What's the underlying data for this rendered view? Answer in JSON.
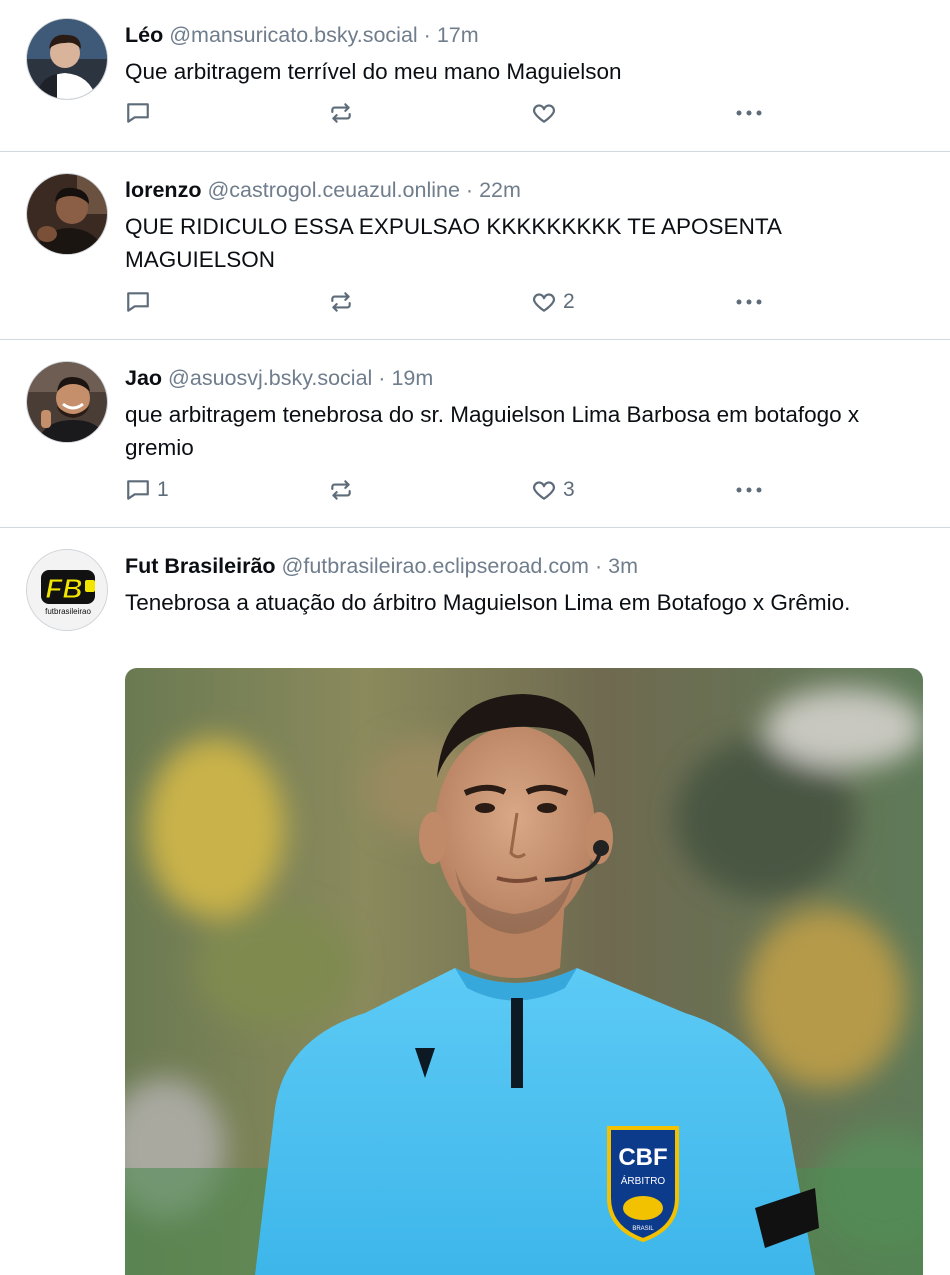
{
  "posts": [
    {
      "author": "Léo",
      "handle": "@mansuricato.bsky.social",
      "separator": "·",
      "time": "17m",
      "text": "Que arbitragem terrível do meu mano Maguielson",
      "reply_count": "",
      "like_count": ""
    },
    {
      "author": "lorenzo",
      "handle": "@castrogol.ceuazul.online",
      "separator": "·",
      "time": "22m",
      "text": "QUE RIDICULO ESSA EXPULSAO KKKKKKKKK TE APOSENTA MAGUIELSON",
      "reply_count": "",
      "like_count": "2"
    },
    {
      "author": "Jao",
      "handle": "@asuosvj.bsky.social",
      "separator": "·",
      "time": "19m",
      "text": "que arbitragem tenebrosa do sr. Maguielson Lima Barbosa em botafogo x gremio",
      "reply_count": "1",
      "like_count": "3"
    },
    {
      "author": "Fut Brasileirão",
      "handle": "@futbrasileirao.eclipseroad.com",
      "separator": "·",
      "time": "3m",
      "text": "Tenebrosa a atuação do árbitro Maguielson Lima em Botafogo x Grêmio.",
      "has_image": true,
      "avatar_logo_text": "FB",
      "avatar_logo_subtext": "futbrasileirao",
      "image": {
        "description_icon": "referee-photo",
        "badge_text": "CBF",
        "badge_subtext": "ÁRBITRO",
        "badge_small": "BRASIL"
      }
    }
  ],
  "icons": {
    "reply": "reply-icon",
    "repost": "repost-icon",
    "like": "like-icon",
    "more": "more-icon"
  },
  "colors": {
    "text": "#0b0f14",
    "muted": "#6f7d8c",
    "action": "#5e6c7a",
    "divider": "#d4d9de",
    "jersey": "#4fc3f2",
    "logo_yellow": "#f2e600"
  }
}
